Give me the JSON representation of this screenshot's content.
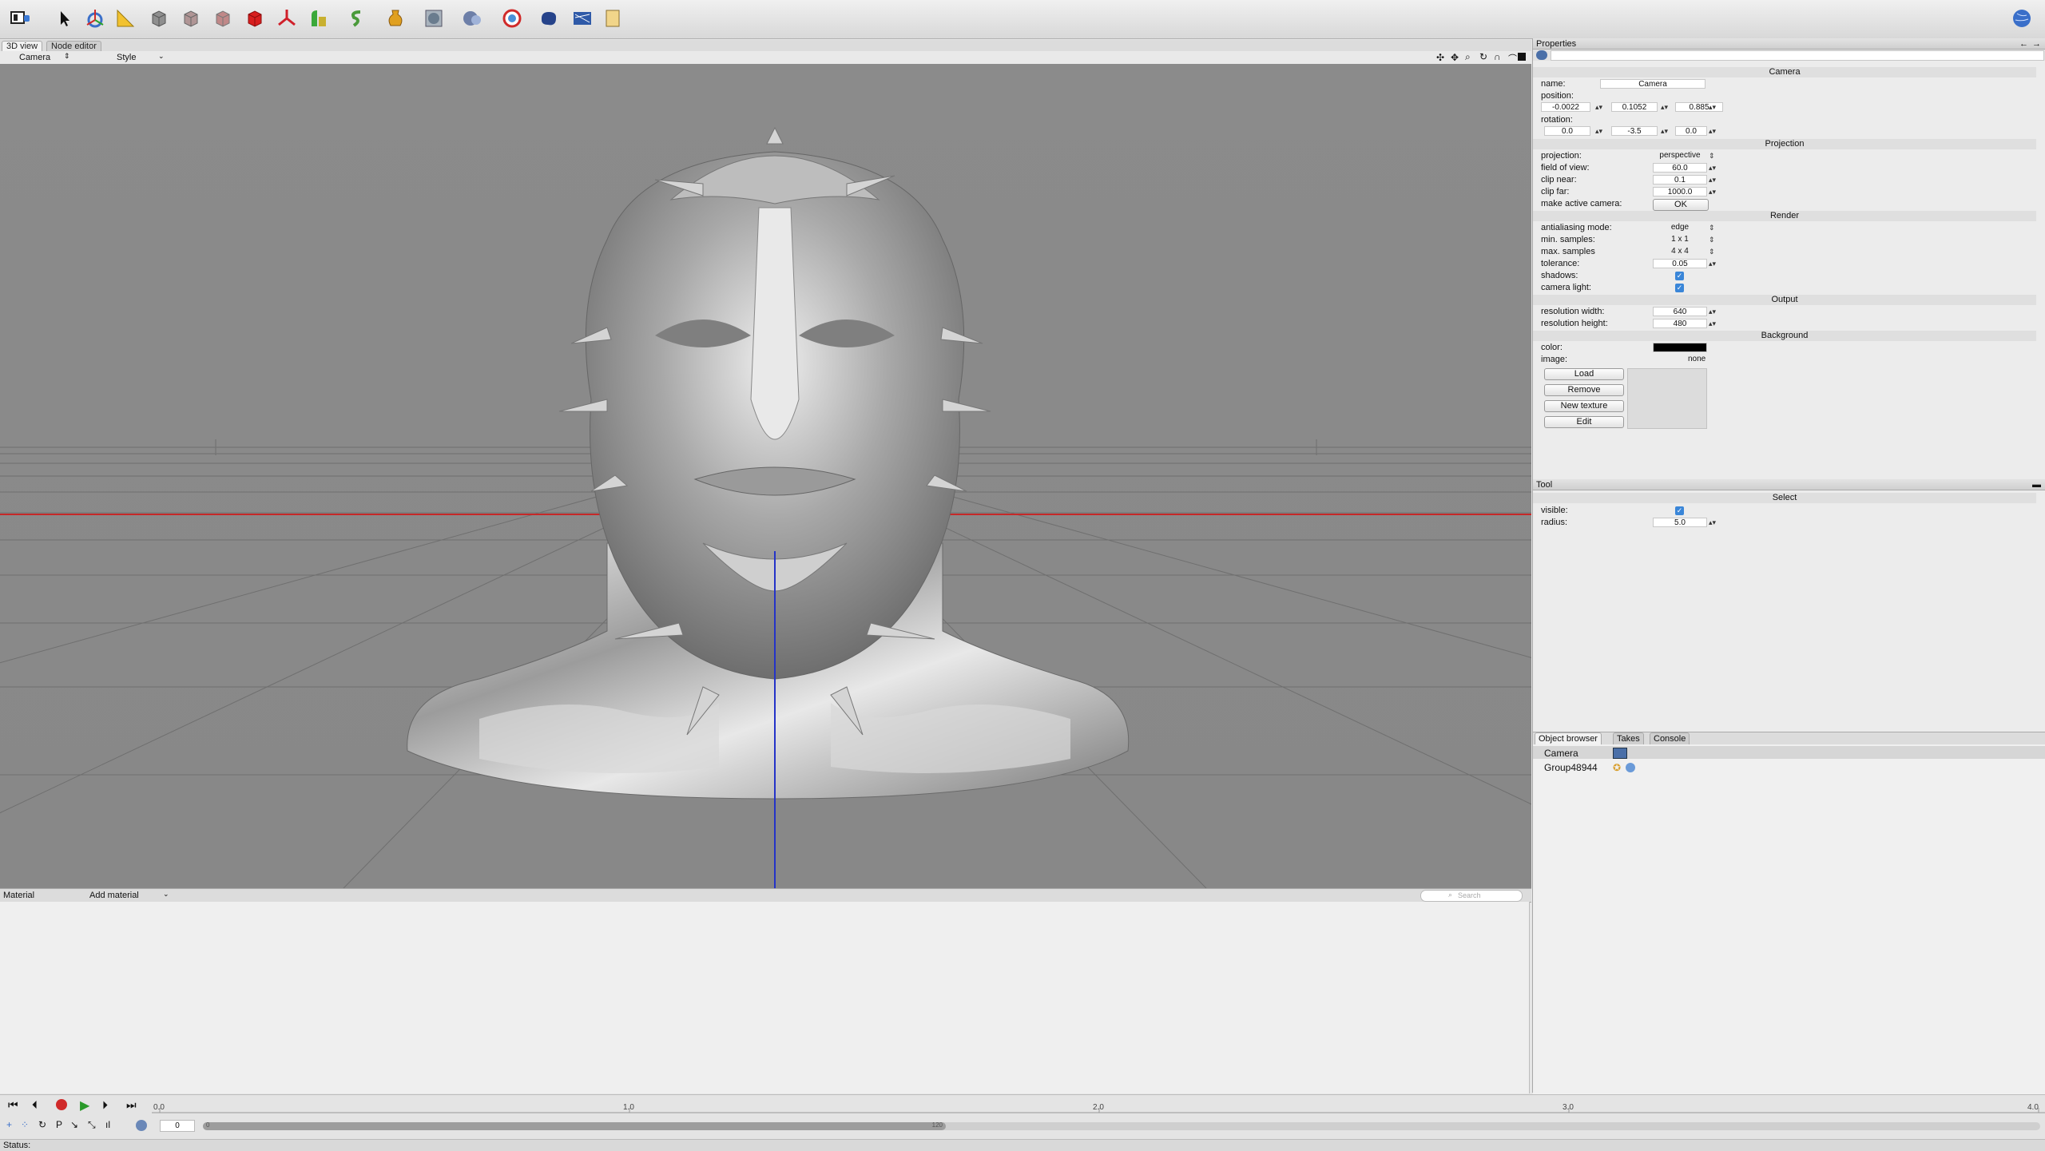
{
  "tabs": {
    "view3d": "3D view",
    "node_editor": "Node editor"
  },
  "view_header": {
    "camera": "Camera",
    "style": "Style"
  },
  "material_bar": {
    "label": "Material",
    "add": "Add material",
    "search_placeholder": "Search"
  },
  "properties": {
    "title": "Properties",
    "camera_section": "Camera",
    "name_label": "name:",
    "name_value": "Camera",
    "position_label": "position:",
    "position": [
      "-0.0022",
      "0.1052",
      "0.885"
    ],
    "rotation_label": "rotation:",
    "rotation": [
      "0.0",
      "-3.5",
      "0.0"
    ],
    "projection_section": "Projection",
    "projection_label": "projection:",
    "projection_value": "perspective",
    "fov_label": "field of view:",
    "fov_value": "60.0",
    "clip_near_label": "clip near:",
    "clip_near_value": "0.1",
    "clip_far_label": "clip far:",
    "clip_far_value": "1000.0",
    "make_active_label": "make active camera:",
    "make_active_button": "OK",
    "render_section": "Render",
    "aa_label": "antialiasing mode:",
    "aa_value": "edge",
    "min_samples_label": "min. samples:",
    "min_samples_value": "1 x 1",
    "max_samples_label": "max. samples",
    "max_samples_value": "4 x 4",
    "tolerance_label": "tolerance:",
    "tolerance_value": "0.05",
    "shadows_label": "shadows:",
    "camera_light_label": "camera light:",
    "output_section": "Output",
    "res_w_label": "resolution width:",
    "res_w_value": "640",
    "res_h_label": "resolution height:",
    "res_h_value": "480",
    "background_section": "Background",
    "color_label": "color:",
    "image_label": "image:",
    "image_value": "none",
    "load_button": "Load",
    "remove_button": "Remove",
    "new_texture_button": "New texture",
    "edit_button": "Edit",
    "bg_color": "#000000"
  },
  "tool": {
    "title": "Tool",
    "section": "Select",
    "visible_label": "visible:",
    "radius_label": "radius:",
    "radius_value": "5.0"
  },
  "object_browser": {
    "tabs": [
      "Object browser",
      "Takes",
      "Console"
    ],
    "items": [
      "Camera",
      "Group48944"
    ]
  },
  "timeline": {
    "frame_value": "0",
    "ticks": [
      "0.0",
      "1.0",
      "2.0",
      "3.0",
      "4.0"
    ],
    "range_start": "0",
    "range_end": "120"
  },
  "status": {
    "label": "Status:"
  }
}
